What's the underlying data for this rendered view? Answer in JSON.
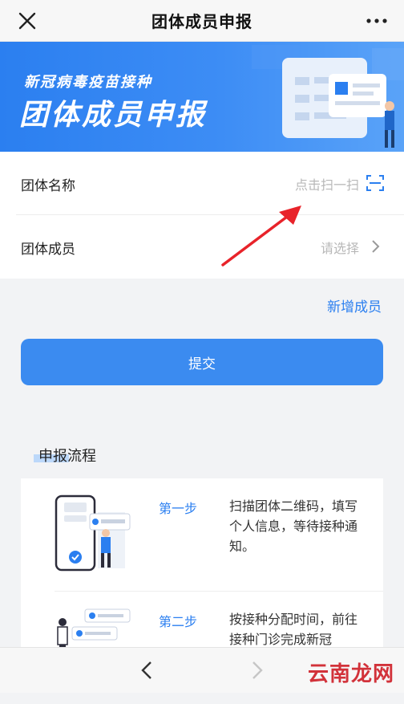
{
  "header": {
    "title": "团体成员申报",
    "close_icon": "close-icon",
    "more_icon": "more-icon"
  },
  "banner": {
    "subtitle": "新冠病毒疫苗接种",
    "title": "团体成员申报",
    "color": "#2b7ff0"
  },
  "form": {
    "group_name": {
      "label": "团体名称",
      "value": "点击扫一扫",
      "icon": "scan-icon"
    },
    "group_members": {
      "label": "团体成员",
      "value": "请选择",
      "icon": "chevron-right-icon"
    }
  },
  "add_member": "新增成员",
  "submit_label": "提交",
  "process": {
    "title": "申报流程",
    "steps": [
      {
        "name": "第一步",
        "desc": "扫描团体二维码，填写个人信息，等待接种通知。"
      },
      {
        "name": "第二步",
        "desc": "按接种分配时间，前往接种门诊完成新冠"
      }
    ]
  },
  "bottom_bar": {
    "back_icon": "chevron-left-icon",
    "forward_icon": "chevron-right-icon",
    "watermark": "云南龙网"
  }
}
